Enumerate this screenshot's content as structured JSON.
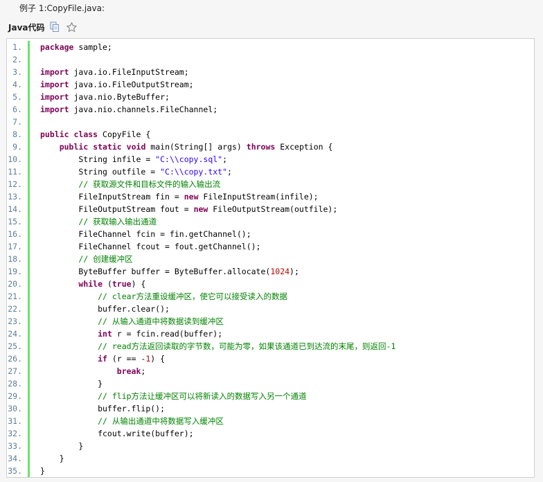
{
  "caption": "例子 1:CopyFile.java:",
  "toolbar": {
    "language": "Java代码",
    "copy_icon": "copy-icon",
    "star_icon": "star-icon"
  },
  "code_lines": [
    [
      [
        "kw",
        "package"
      ],
      [
        "t",
        " sample;"
      ]
    ],
    [],
    [
      [
        "kw",
        "import"
      ],
      [
        "t",
        " java.io.FileInputStream;"
      ]
    ],
    [
      [
        "kw",
        "import"
      ],
      [
        "t",
        " java.io.FileOutputStream;"
      ]
    ],
    [
      [
        "kw",
        "import"
      ],
      [
        "t",
        " java.nio.ByteBuffer;"
      ]
    ],
    [
      [
        "kw",
        "import"
      ],
      [
        "t",
        " java.nio.channels.FileChannel;"
      ]
    ],
    [],
    [
      [
        "kw",
        "public"
      ],
      [
        "t",
        " "
      ],
      [
        "kw",
        "class"
      ],
      [
        "t",
        " CopyFile {"
      ]
    ],
    [
      [
        "t",
        "    "
      ],
      [
        "kw",
        "public"
      ],
      [
        "t",
        " "
      ],
      [
        "kw",
        "static"
      ],
      [
        "t",
        " "
      ],
      [
        "kw",
        "void"
      ],
      [
        "t",
        " main(String[] args) "
      ],
      [
        "kw",
        "throws"
      ],
      [
        "t",
        " Exception {"
      ]
    ],
    [
      [
        "t",
        "        String infile = "
      ],
      [
        "str",
        "\"C:\\\\copy.sql\""
      ],
      [
        "t",
        ";"
      ]
    ],
    [
      [
        "t",
        "        String outfile = "
      ],
      [
        "str",
        "\"C:\\\\copy.txt\""
      ],
      [
        "t",
        ";"
      ]
    ],
    [
      [
        "t",
        "        "
      ],
      [
        "cm",
        "// 获取源文件和目标文件的输入输出流"
      ]
    ],
    [
      [
        "t",
        "        FileInputStream fin = "
      ],
      [
        "kw",
        "new"
      ],
      [
        "t",
        " FileInputStream(infile);"
      ]
    ],
    [
      [
        "t",
        "        FileOutputStream fout = "
      ],
      [
        "kw",
        "new"
      ],
      [
        "t",
        " FileOutputStream(outfile);"
      ]
    ],
    [
      [
        "t",
        "        "
      ],
      [
        "cm",
        "// 获取输入输出通道"
      ]
    ],
    [
      [
        "t",
        "        FileChannel fcin = fin.getChannel();"
      ]
    ],
    [
      [
        "t",
        "        FileChannel fcout = fout.getChannel();"
      ]
    ],
    [
      [
        "t",
        "        "
      ],
      [
        "cm",
        "// 创建缓冲区"
      ]
    ],
    [
      [
        "t",
        "        ByteBuffer buffer = ByteBuffer.allocate("
      ],
      [
        "num",
        "1024"
      ],
      [
        "t",
        ");"
      ]
    ],
    [
      [
        "t",
        "        "
      ],
      [
        "kw",
        "while"
      ],
      [
        "t",
        " ("
      ],
      [
        "kw",
        "true"
      ],
      [
        "t",
        ") {"
      ]
    ],
    [
      [
        "t",
        "            "
      ],
      [
        "cm",
        "// clear方法重设缓冲区，使它可以接受读入的数据"
      ]
    ],
    [
      [
        "t",
        "            buffer.clear();"
      ]
    ],
    [
      [
        "t",
        "            "
      ],
      [
        "cm",
        "// 从输入通道中将数据读到缓冲区"
      ]
    ],
    [
      [
        "t",
        "            "
      ],
      [
        "kw",
        "int"
      ],
      [
        "t",
        " r = fcin.read(buffer);"
      ]
    ],
    [
      [
        "t",
        "            "
      ],
      [
        "cm",
        "// read方法返回读取的字节数，可能为零，如果该通道已到达流的末尾，则返回-1"
      ]
    ],
    [
      [
        "t",
        "            "
      ],
      [
        "kw",
        "if"
      ],
      [
        "t",
        " (r == -"
      ],
      [
        "num",
        "1"
      ],
      [
        "t",
        ") {"
      ]
    ],
    [
      [
        "t",
        "                "
      ],
      [
        "kw",
        "break"
      ],
      [
        "t",
        ";"
      ]
    ],
    [
      [
        "t",
        "            }"
      ]
    ],
    [
      [
        "t",
        "            "
      ],
      [
        "cm",
        "// flip方法让缓冲区可以将新读入的数据写入另一个通道"
      ]
    ],
    [
      [
        "t",
        "            buffer.flip();"
      ]
    ],
    [
      [
        "t",
        "            "
      ],
      [
        "cm",
        "// 从输出通道中将数据写入缓冲区"
      ]
    ],
    [
      [
        "t",
        "            fcout.write(buffer);"
      ]
    ],
    [
      [
        "t",
        "        }"
      ]
    ],
    [
      [
        "t",
        "    }"
      ]
    ],
    [
      [
        "t",
        "}"
      ]
    ]
  ]
}
